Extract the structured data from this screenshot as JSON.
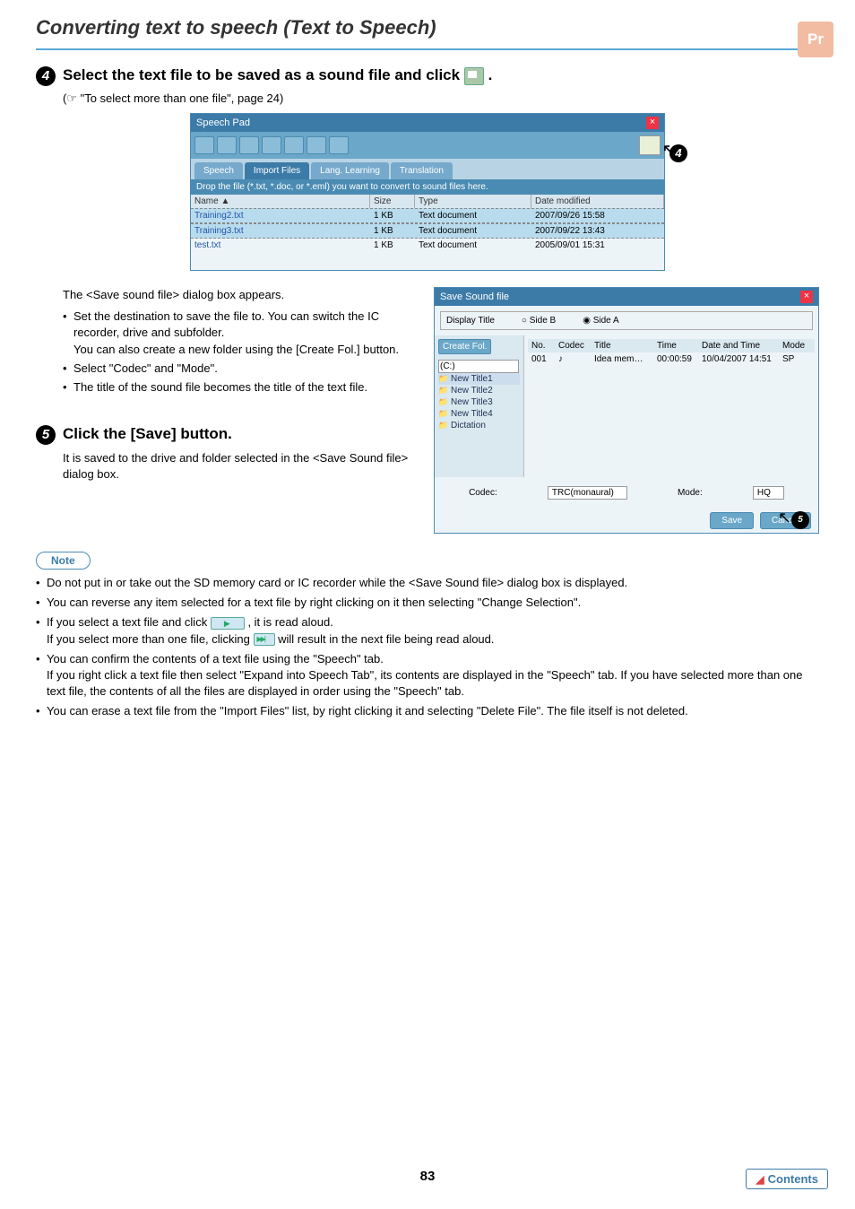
{
  "header": {
    "title": "Converting text to speech (Text to Speech)",
    "badge": "Pr"
  },
  "step4": {
    "number": "4",
    "title_pre": "Select the text file to be saved as a sound file and click ",
    "title_post": ".",
    "subref": "(☞ \"To select more than one file\", page 24)"
  },
  "speechpad": {
    "title": "Speech Pad",
    "tabs": [
      "Speech",
      "Import Files",
      "Lang. Learning",
      "Translation"
    ],
    "hint": "Drop the file (*.txt, *.doc, or *.eml) you want to convert to sound files here.",
    "columns": {
      "name": "Name ▲",
      "size": "Size",
      "type": "Type",
      "date": "Date modified"
    },
    "rows": [
      {
        "name": "Training2.txt",
        "size": "1 KB",
        "type": "Text document",
        "date": "2007/09/26 15:58"
      },
      {
        "name": "Training3.txt",
        "size": "1 KB",
        "type": "Text document",
        "date": "2007/09/22 13:43"
      },
      {
        "name": "test.txt",
        "size": "1 KB",
        "type": "Text document",
        "date": "2005/09/01 15:31"
      }
    ],
    "callout": "4"
  },
  "explain": {
    "intro": "The <Save sound file> dialog box appears.",
    "bullets": [
      "Set the destination to save the file to. You can switch the IC recorder, drive and subfolder.\nYou can also create a new folder using the [Create Fol.] button.",
      "Select \"Codec\" and \"Mode\".",
      "The title of the sound file becomes the title of the text file."
    ]
  },
  "savefile": {
    "title": "Save Sound file",
    "create_btn": "Create Fol.",
    "drive": "(C:)",
    "folders": [
      "New Title1",
      "New Title2",
      "New Title3",
      "New Title4",
      "Dictation"
    ],
    "display_title_label": "Display Title",
    "side_b": "Side B",
    "side_a": "Side A",
    "list_head": {
      "no": "No.",
      "codec": "Codec",
      "title": "Title",
      "time": "Time",
      "date": "Date and Time",
      "mode": "Mode"
    },
    "list_row": {
      "no": "001",
      "codec": "♪",
      "title": "Idea mem…",
      "time": "00:00:59",
      "date": "10/04/2007 14:51",
      "mode": "SP"
    },
    "codec_label": "Codec:",
    "codec_value": "TRC(monaural)",
    "mode_label": "Mode:",
    "mode_value": "HQ",
    "save_btn": "Save",
    "cancel_btn": "Cancel",
    "callout": "5"
  },
  "step5": {
    "number": "5",
    "title": "Click the [Save] button.",
    "desc": "It is saved to the drive and folder selected in the <Save Sound file> dialog box."
  },
  "note": {
    "label": "Note",
    "items": [
      "Do not put in or take out the SD memory card or IC recorder while the <Save Sound file> dialog box is displayed.",
      "You can reverse any item selected for a text file by right clicking on it then selecting \"Change Selection\"."
    ],
    "item3_pre": "If you select a text file and click ",
    "item3_mid": ", it is read aloud.",
    "item3_b_pre": "If you select more than one file, clicking ",
    "item3_b_post": " will result in the next file being read aloud.",
    "item4_a": "You can confirm the contents of a text file using the \"Speech\" tab.",
    "item4_b": "If you right click a text file then select \"Expand into Speech Tab\", its contents are displayed in the \"Speech\" tab. If you have selected more than one text file, the contents of all the files are displayed in order using the \"Speech\" tab.",
    "item5": "You can erase a text file from the \"Import Files\" list, by right clicking it and selecting \"Delete File\". The file itself is not deleted."
  },
  "footer": {
    "page": "83",
    "contents": "Contents"
  }
}
